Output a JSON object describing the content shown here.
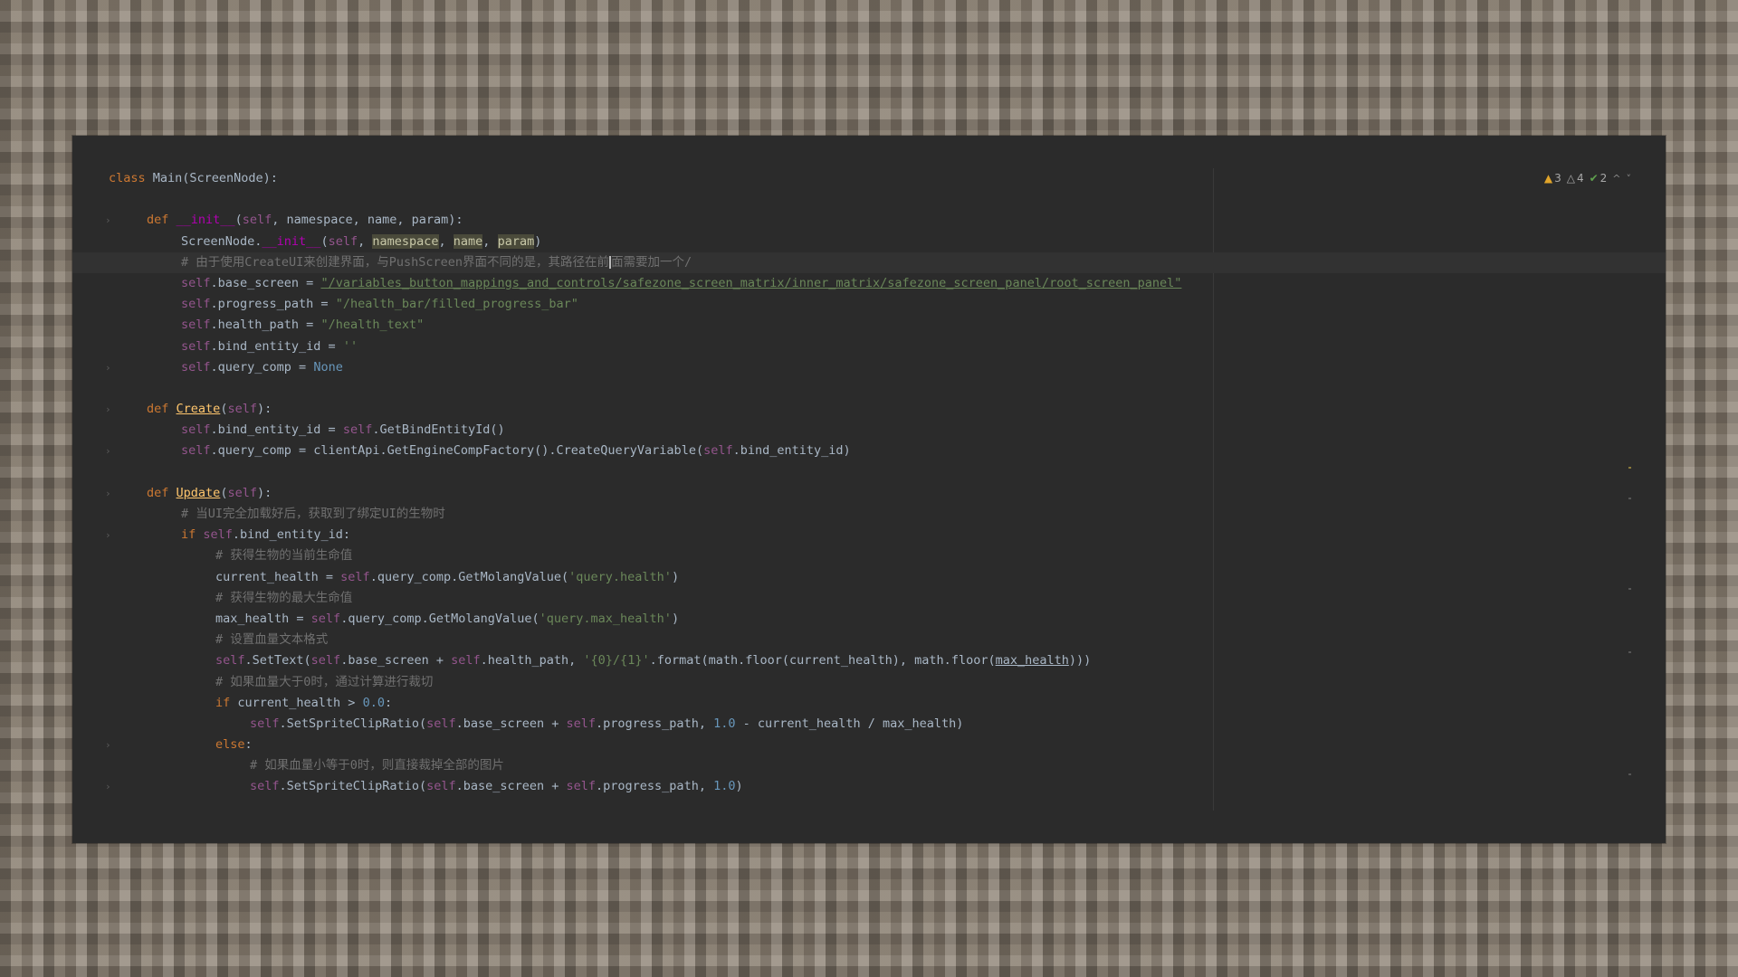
{
  "indicators": {
    "warnings": "3",
    "weak_warnings": "4",
    "typos": "2",
    "warning_icon": "warning-triangle-icon",
    "weak_warning_icon": "weak-warning-triangle-icon",
    "typo_icon": "check-icon",
    "up": "^",
    "down": "˅"
  },
  "code": {
    "l1": {
      "a": "class",
      "b": " Main(ScreenNode):"
    },
    "l3": {
      "a": "def",
      "b": " ",
      "c": "__init__",
      "d": "(",
      "e": "self",
      "f": ", namespace, name, param):"
    },
    "l4": {
      "a": "ScreenNode.",
      "b": "__init__",
      "c": "(",
      "d": "self",
      "e": ", ",
      "f": "namespace",
      "g": ", ",
      "h": "name",
      "i": ", ",
      "j": "param",
      "k": ")"
    },
    "l5": {
      "a": "# 由于使用CreateUI来创建界面，与PushScreen界面不同的是，其路径在前",
      "b": "面需要加一个/"
    },
    "l6": {
      "a": "self",
      "b": ".base_screen = ",
      "c": "\"/variables_button_mappings_and_controls/safezone_screen_matrix/inner_matrix/safezone_screen_panel/root_screen_panel\""
    },
    "l7": {
      "a": "self",
      "b": ".progress_path = ",
      "c": "\"/health_bar/filled_progress_bar\""
    },
    "l8": {
      "a": "self",
      "b": ".health_path = ",
      "c": "\"/health_text\""
    },
    "l9": {
      "a": "self",
      "b": ".bind_entity_id = ",
      "c": "''"
    },
    "l10": {
      "a": "self",
      "b": ".query_comp = ",
      "c": "None"
    },
    "l12": {
      "a": "def",
      "b": " ",
      "c": "Create",
      "d": "(",
      "e": "self",
      "f": "):"
    },
    "l13": {
      "a": "self",
      "b": ".bind_entity_id = ",
      "c": "self",
      "d": ".GetBindEntityId()"
    },
    "l14": {
      "a": "self",
      "b": ".query_comp = clientApi.GetEngineCompFactory().CreateQueryVariable(",
      "c": "self",
      "d": ".bind_entity_id)"
    },
    "l16": {
      "a": "def",
      "b": " ",
      "c": "Update",
      "d": "(",
      "e": "self",
      "f": "):"
    },
    "l17": {
      "a": "# 当UI完全加载好后，获取到了绑定UI的生物时"
    },
    "l18": {
      "a": "if",
      "b": " ",
      "c": "self",
      "d": ".bind_entity_id:"
    },
    "l19": {
      "a": "# 获得生物的当前生命值"
    },
    "l20": {
      "a": "current_health = ",
      "b": "self",
      "c": ".query_comp.GetMolangValue(",
      "d": "'query.health'",
      "e": ")"
    },
    "l21": {
      "a": "# 获得生物的最大生命值"
    },
    "l22": {
      "a": "max_health = ",
      "b": "self",
      "c": ".query_comp.GetMolangValue(",
      "d": "'query.max_health'",
      "e": ")"
    },
    "l23": {
      "a": "# 设置血量文本格式"
    },
    "l24": {
      "a": "self",
      "b": ".SetText(",
      "c": "self",
      "d": ".base_screen + ",
      "e": "self",
      "f": ".health_path, ",
      "g": "'{0}/{1}'",
      "h": ".format(math.floor(current_health), math.floor(",
      "i": "max_health",
      "j": ")))"
    },
    "l25": {
      "a": "# 如果血量大于0时，通过计算进行裁切"
    },
    "l26": {
      "a": "if",
      "b": " current_health > ",
      "c": "0.0",
      "d": ":"
    },
    "l27": {
      "a": "self",
      "b": ".SetSpriteClipRatio(",
      "c": "self",
      "d": ".base_screen + ",
      "e": "self",
      "f": ".progress_path, ",
      "g": "1.0",
      "h": " - current_health / max_health)"
    },
    "l28": {
      "a": "else",
      "b": ":"
    },
    "l29": {
      "a": "# 如果血量小等于0时，则直接裁掉全部的图片"
    },
    "l30": {
      "a": "self",
      "b": ".SetSpriteClipRatio(",
      "c": "self",
      "d": ".base_screen + ",
      "e": "self",
      "f": ".progress_path, ",
      "g": "1.0",
      "h": ")"
    }
  }
}
